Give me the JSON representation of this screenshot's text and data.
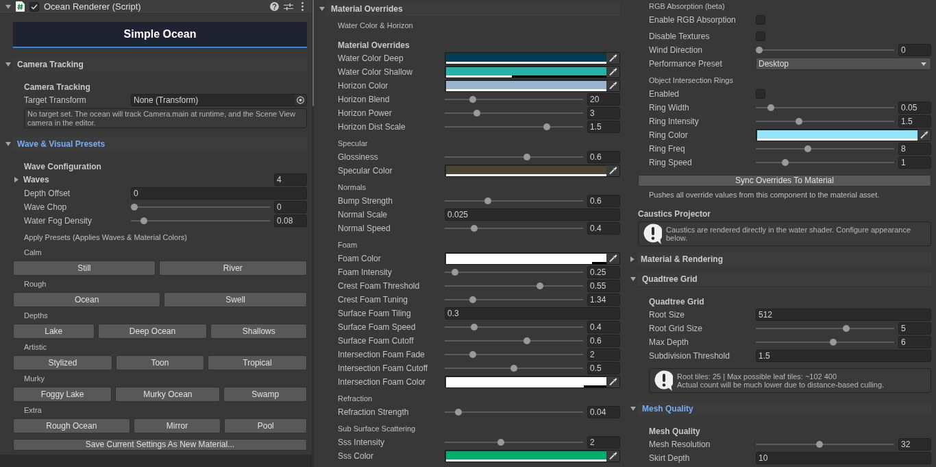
{
  "panels": [
    {
      "items": [
        {
          "kind": "component_header",
          "title": "Ocean Renderer (Script)",
          "expanded": true,
          "enabled": true
        },
        {
          "kind": "banner",
          "title": "Simple Ocean"
        },
        {
          "kind": "foldout",
          "label": "Camera Tracking",
          "expanded": true,
          "highlighted": false,
          "items": [
            {
              "kind": "heading",
              "text": "Camera Tracking"
            },
            {
              "kind": "object",
              "label": "Target Transform",
              "value": "None (Transform)"
            },
            {
              "kind": "note_box",
              "text": "No target set. The ocean will track Camera.main at runtime, and the Scene View camera in the editor."
            }
          ]
        },
        {
          "kind": "foldout",
          "label": "Wave & Visual Presets",
          "expanded": true,
          "highlighted": true,
          "items": [
            {
              "kind": "heading",
              "text": "Wave Configuration"
            },
            {
              "kind": "array",
              "label": "Waves",
              "expanded": false,
              "value": "4"
            },
            {
              "kind": "field",
              "label": "Depth Offset",
              "value": "0"
            },
            {
              "kind": "slider",
              "label": "Wave Chop",
              "level": 0,
              "value": "0"
            },
            {
              "kind": "slider",
              "label": "Water Fog Density",
              "level": 0.07,
              "value": "0.08"
            },
            {
              "kind": "caption",
              "text": "Apply Presets (Applies Waves & Material Colors)"
            },
            {
              "kind": "caption",
              "text": "Calm"
            },
            {
              "kind": "buttons",
              "buttons": [
                "Still",
                "River"
              ]
            },
            {
              "kind": "caption",
              "text": "Rough"
            },
            {
              "kind": "buttons",
              "buttons": [
                "Ocean",
                "Swell"
              ]
            },
            {
              "kind": "caption",
              "text": "Depths"
            },
            {
              "kind": "buttons",
              "buttons": [
                "Lake",
                "Deep Ocean",
                "Shallows"
              ]
            },
            {
              "kind": "caption",
              "text": "Artistic"
            },
            {
              "kind": "buttons",
              "buttons": [
                "Stylized",
                "Toon",
                "Tropical"
              ]
            },
            {
              "kind": "caption",
              "text": "Murky"
            },
            {
              "kind": "buttons",
              "buttons": [
                "Foggy Lake",
                "Murky Ocean",
                "Swamp"
              ]
            },
            {
              "kind": "caption",
              "text": "Extra"
            },
            {
              "kind": "buttons",
              "buttons": [
                "Rough Ocean",
                "Mirror",
                "Pool"
              ]
            },
            {
              "kind": "button",
              "label": "Save Current Settings As New Material..."
            }
          ]
        }
      ]
    },
    {
      "items": [
        {
          "kind": "foldout",
          "label": "Material Overrides",
          "expanded": true,
          "highlighted": false,
          "items": [
            {
              "kind": "caption",
              "text": "Water Color & Horizon"
            },
            {
              "kind": "heading",
              "text": "Material Overrides"
            },
            {
              "kind": "color",
              "label": "Water Color Deep",
              "color": "#023d57",
              "level": 1
            },
            {
              "kind": "color",
              "label": "Water Color Shallow",
              "color": "#26b3a6",
              "level": 0.41
            },
            {
              "kind": "color",
              "label": "Horizon Color",
              "color": "#9ab4cf",
              "level": 1
            },
            {
              "kind": "slider",
              "label": "Horizon Blend",
              "level": 0.19,
              "value": "20"
            },
            {
              "kind": "slider",
              "label": "Horizon Power",
              "level": 0.22,
              "value": "3"
            },
            {
              "kind": "slider",
              "label": "Horizon Dist Scale",
              "level": 0.75,
              "value": "1.5"
            },
            {
              "kind": "caption",
              "text": "Specular"
            },
            {
              "kind": "slider",
              "label": "Glossiness",
              "level": 0.6,
              "value": "0.6"
            },
            {
              "kind": "color",
              "label": "Specular Color",
              "color": "#4a4430",
              "level": 1
            },
            {
              "kind": "caption",
              "text": "Normals"
            },
            {
              "kind": "slider",
              "label": "Bump Strength",
              "level": 0.3,
              "value": "0.6"
            },
            {
              "kind": "field",
              "label": "Normal Scale",
              "value": "0.025"
            },
            {
              "kind": "slider",
              "label": "Normal Speed",
              "level": 0.2,
              "value": "0.4"
            },
            {
              "kind": "caption",
              "text": "Foam"
            },
            {
              "kind": "color",
              "label": "Foam Color",
              "color": "#ffffff",
              "level": 0.91
            },
            {
              "kind": "slider",
              "label": "Foam Intensity",
              "level": 0.05,
              "value": "0.25"
            },
            {
              "kind": "slider",
              "label": "Crest Foam Threshold",
              "level": 0.7,
              "value": "0.55"
            },
            {
              "kind": "slider",
              "label": "Crest Foam Tuning",
              "level": 0.19,
              "value": "1.34"
            },
            {
              "kind": "field",
              "label": "Surface Foam Tiling",
              "value": "0.3"
            },
            {
              "kind": "slider",
              "label": "Surface Foam Speed",
              "level": 0.2,
              "value": "0.4"
            },
            {
              "kind": "slider",
              "label": "Surface Foam Cutoff",
              "level": 0.6,
              "value": "0.6"
            },
            {
              "kind": "slider",
              "label": "Intersection Foam Fade",
              "level": 0.19,
              "value": "2"
            },
            {
              "kind": "slider",
              "label": "Intersection Foam Cutoff",
              "level": 0.5,
              "value": "0.5"
            },
            {
              "kind": "color",
              "label": "Intersection Foam Color",
              "color": "#ffffff",
              "level": 0.86
            },
            {
              "kind": "caption",
              "text": "Refraction"
            },
            {
              "kind": "slider",
              "label": "Refraction Strength",
              "level": 0.08,
              "value": "0.04"
            },
            {
              "kind": "caption",
              "text": "Sub Surface Scattering"
            },
            {
              "kind": "slider",
              "label": "Sss Intensity",
              "level": 0.4,
              "value": "2"
            },
            {
              "kind": "color",
              "label": "Sss Color",
              "color": "#00b06a",
              "level": 1
            }
          ]
        }
      ]
    },
    {
      "items": [
        {
          "kind": "caption",
          "text": "RGB Absorption (beta)"
        },
        {
          "kind": "checkbox",
          "label": "Enable RGB Absorption",
          "checked": false
        },
        {
          "kind": "checkbox",
          "label": "Disable Textures",
          "checked": false
        },
        {
          "kind": "slider",
          "label": "Wind Direction",
          "level": 0,
          "value": "0"
        },
        {
          "kind": "dropdown",
          "label": "Performance Preset",
          "value": "Desktop"
        },
        {
          "kind": "caption",
          "text": "Object Intersection Rings"
        },
        {
          "kind": "checkbox",
          "label": "Enabled",
          "checked": false
        },
        {
          "kind": "slider",
          "label": "Ring Width",
          "level": 0.09,
          "value": "0.05"
        },
        {
          "kind": "slider",
          "label": "Ring Intensity",
          "level": 0.3,
          "value": "1.5"
        },
        {
          "kind": "color",
          "label": "Ring Color",
          "color": "#94e4fb",
          "level": 1
        },
        {
          "kind": "slider",
          "label": "Ring Freq",
          "level": 0.37,
          "value": "8"
        },
        {
          "kind": "slider",
          "label": "Ring Speed",
          "level": 0.2,
          "value": "1"
        },
        {
          "kind": "button",
          "label": "Sync Overrides To Material"
        },
        {
          "kind": "caption",
          "text": "Pushes all override values from this component to the material asset."
        },
        {
          "kind": "section",
          "title": "Caustics Projector",
          "items": [
            {
              "kind": "info_box",
              "text": "Caustics are rendered directly in the water shader. Configure appearance below."
            }
          ]
        },
        {
          "kind": "foldout",
          "label": "Material & Rendering",
          "expanded": false,
          "highlighted": false
        },
        {
          "kind": "foldout",
          "label": "Quadtree Grid",
          "expanded": true,
          "highlighted": false,
          "items": [
            {
              "kind": "heading",
              "text": "Quadtree Grid"
            },
            {
              "kind": "field",
              "label": "Root Size",
              "value": "512"
            },
            {
              "kind": "slider",
              "label": "Root Grid Size",
              "level": 0.66,
              "value": "5"
            },
            {
              "kind": "slider",
              "label": "Max Depth",
              "level": 0.56,
              "value": "6"
            },
            {
              "kind": "field",
              "label": "Subdivision Threshold",
              "value": "1.5"
            },
            {
              "kind": "info_box",
              "text": "Root tiles: 25 | Max possible leaf tiles: ~102 400\nActual count will be much lower due to distance-based culling."
            }
          ]
        },
        {
          "kind": "foldout",
          "label": "Mesh Quality",
          "expanded": true,
          "highlighted": true,
          "items": [
            {
              "kind": "heading",
              "text": "Mesh Quality"
            },
            {
              "kind": "slider",
              "label": "Mesh Resolution",
              "level": 0.46,
              "value": "32"
            },
            {
              "kind": "field",
              "label": "Skirt Depth",
              "value": "10"
            }
          ]
        }
      ]
    }
  ]
}
